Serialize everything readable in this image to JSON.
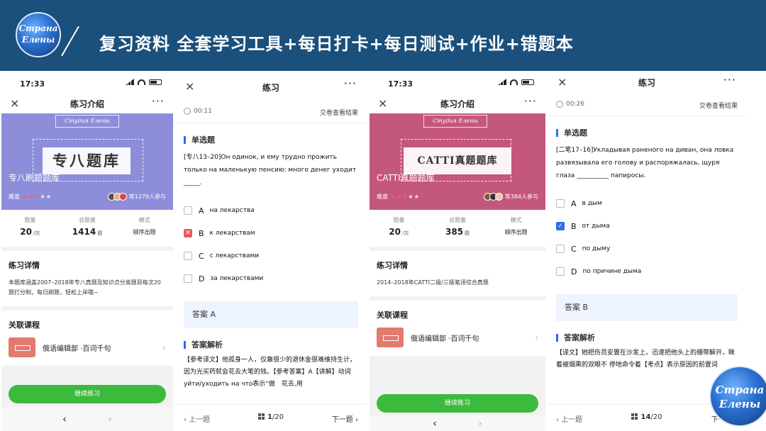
{
  "banner": {
    "logo_line1": "Страна",
    "logo_line2": "Елены",
    "title": "复习资料  全套学习工具+每日打卡+每日测试+作业+错题本"
  },
  "status": {
    "time": "17:33"
  },
  "screen1": {
    "nav_title": "练习介绍",
    "close_icon": "×",
    "more_icon": "···",
    "cover": {
      "brand": "Студия Елены",
      "plate": "专八题库",
      "title": "专八刷题题库",
      "difficulty_label": "难度",
      "rating": 3,
      "participants": "等1279人参与",
      "color": "#8c8ed9"
    },
    "stats": [
      {
        "label": "题量",
        "value": "20",
        "unit": "/次"
      },
      {
        "label": "总题量",
        "value": "1414",
        "unit": "题"
      },
      {
        "label": "模式",
        "value": "顺序出题"
      }
    ],
    "detail_title": "练习详情",
    "detail_text": "本题库涵盖2007–2018年专八真题及知识点分类题目每次20题打分制，每日刷题，轻松上岸哦~",
    "related_title": "关联课程",
    "course_name": "俄语编辑部 ·百词千句",
    "cta": "继续练习",
    "nav_prev": "‹",
    "nav_next": "›"
  },
  "screen2": {
    "title": "练习",
    "close_icon": "×",
    "more_icon": "···",
    "timer": "00:11",
    "submit": "交卷查看结果",
    "qtype": "单选题",
    "question": "[专八13–20]Он одинок, и ему трудно прожить только на маленькую пенсию: много денег уходит _____.",
    "options": [
      {
        "letter": "A",
        "text": "на лекарства",
        "state": "none"
      },
      {
        "letter": "B",
        "text": "к лекарствам",
        "state": "wrong"
      },
      {
        "letter": "C",
        "text": "с лекарствами",
        "state": "none"
      },
      {
        "letter": "D",
        "text": "за лекарствами",
        "state": "none"
      }
    ],
    "answer": "答案 A",
    "analysis_title": "答案解析",
    "analysis_text": "【参考译文】他孤身一人，仅靠很少的退休金很难维持生计，因为光买药就会花去大笔的钱。【参考答案】A【讲解】动词уйти/уходить на что表示“做　花去,用",
    "prev": "上一题",
    "page": "1",
    "total": "/20",
    "next": "下一题"
  },
  "screen3": {
    "nav_title": "练习介绍",
    "close_icon": "×",
    "more_icon": "···",
    "cover": {
      "brand": "Студия Елены",
      "plate": "CATTI真题题库",
      "title": "CATTI真题题库",
      "difficulty_label": "难度",
      "rating": 3,
      "participants": "等384人参与",
      "color": "#c4577e"
    },
    "stats": [
      {
        "label": "题量",
        "value": "20",
        "unit": "/次"
      },
      {
        "label": "总题量",
        "value": "385",
        "unit": "题"
      },
      {
        "label": "模式",
        "value": "顺序出题"
      }
    ],
    "detail_title": "练习详情",
    "detail_text": "2014–2018年CATTI二级/三级笔译综合真题",
    "related_title": "关联课程",
    "course_name": "俄语编辑部 ·百词千句",
    "cta": "继续练习",
    "nav_prev": "‹",
    "nav_next": "›"
  },
  "screen4": {
    "title": "练习",
    "close_icon": "×",
    "more_icon": "···",
    "timer": "00:26",
    "submit": "交卷查看结果",
    "qtype": "单选题",
    "question": "[二笔17–16]Укладывая раненого на диван, она ловка развязывала его голову и распоряжалась, щуря глаза __________ папиросы.",
    "options": [
      {
        "letter": "A",
        "text": "в дым",
        "state": "none"
      },
      {
        "letter": "B",
        "text": "от дыма",
        "state": "right"
      },
      {
        "letter": "C",
        "text": "по дыму",
        "state": "none"
      },
      {
        "letter": "D",
        "text": "по причине дыма",
        "state": "none"
      }
    ],
    "answer": "答案 B",
    "analysis_title": "答案解析",
    "analysis_text": "【译文】她把伤员安置在沙发上，迅速把他头上的绷带解开，眯着被烟熏的双眼不 停地命令着【考点】表示原因的前置词",
    "prev": "上一题",
    "page": "14",
    "total": "/20",
    "next": "下一题"
  },
  "colors": {
    "banner": "#1b4f7c",
    "green": "#3cba3c",
    "blue": "#2b6ee8",
    "red": "#f05a5a"
  }
}
